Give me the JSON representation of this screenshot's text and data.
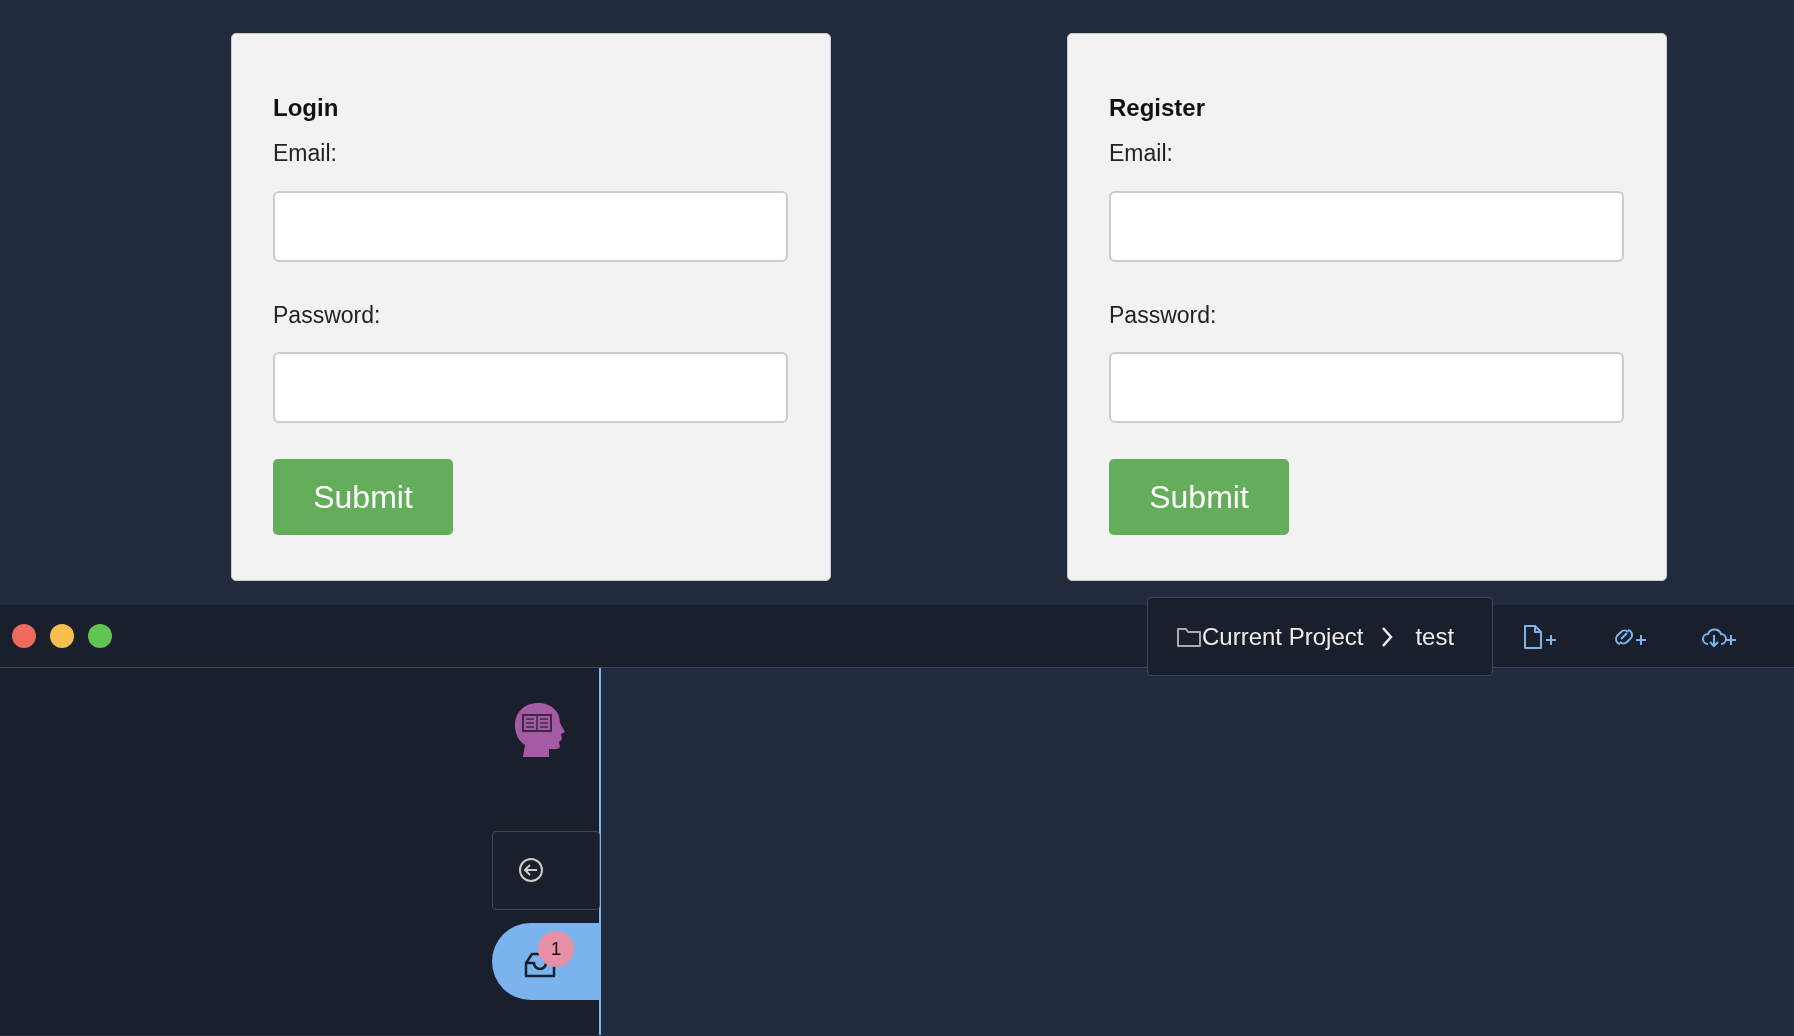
{
  "forms": [
    {
      "title": "Login",
      "fields": [
        {
          "label": "Email:"
        },
        {
          "label": "Password:"
        }
      ],
      "submit": "Submit"
    },
    {
      "title": "Register",
      "fields": [
        {
          "label": "Email:"
        },
        {
          "label": "Password:"
        }
      ],
      "submit": "Submit"
    }
  ],
  "breadcrumb": [
    "Current Project",
    "test"
  ],
  "sidebar": {
    "items": [
      {
        "kind": "back",
        "selected": false
      },
      {
        "kind": "inbox",
        "selected": true,
        "badge": "1"
      }
    ]
  }
}
